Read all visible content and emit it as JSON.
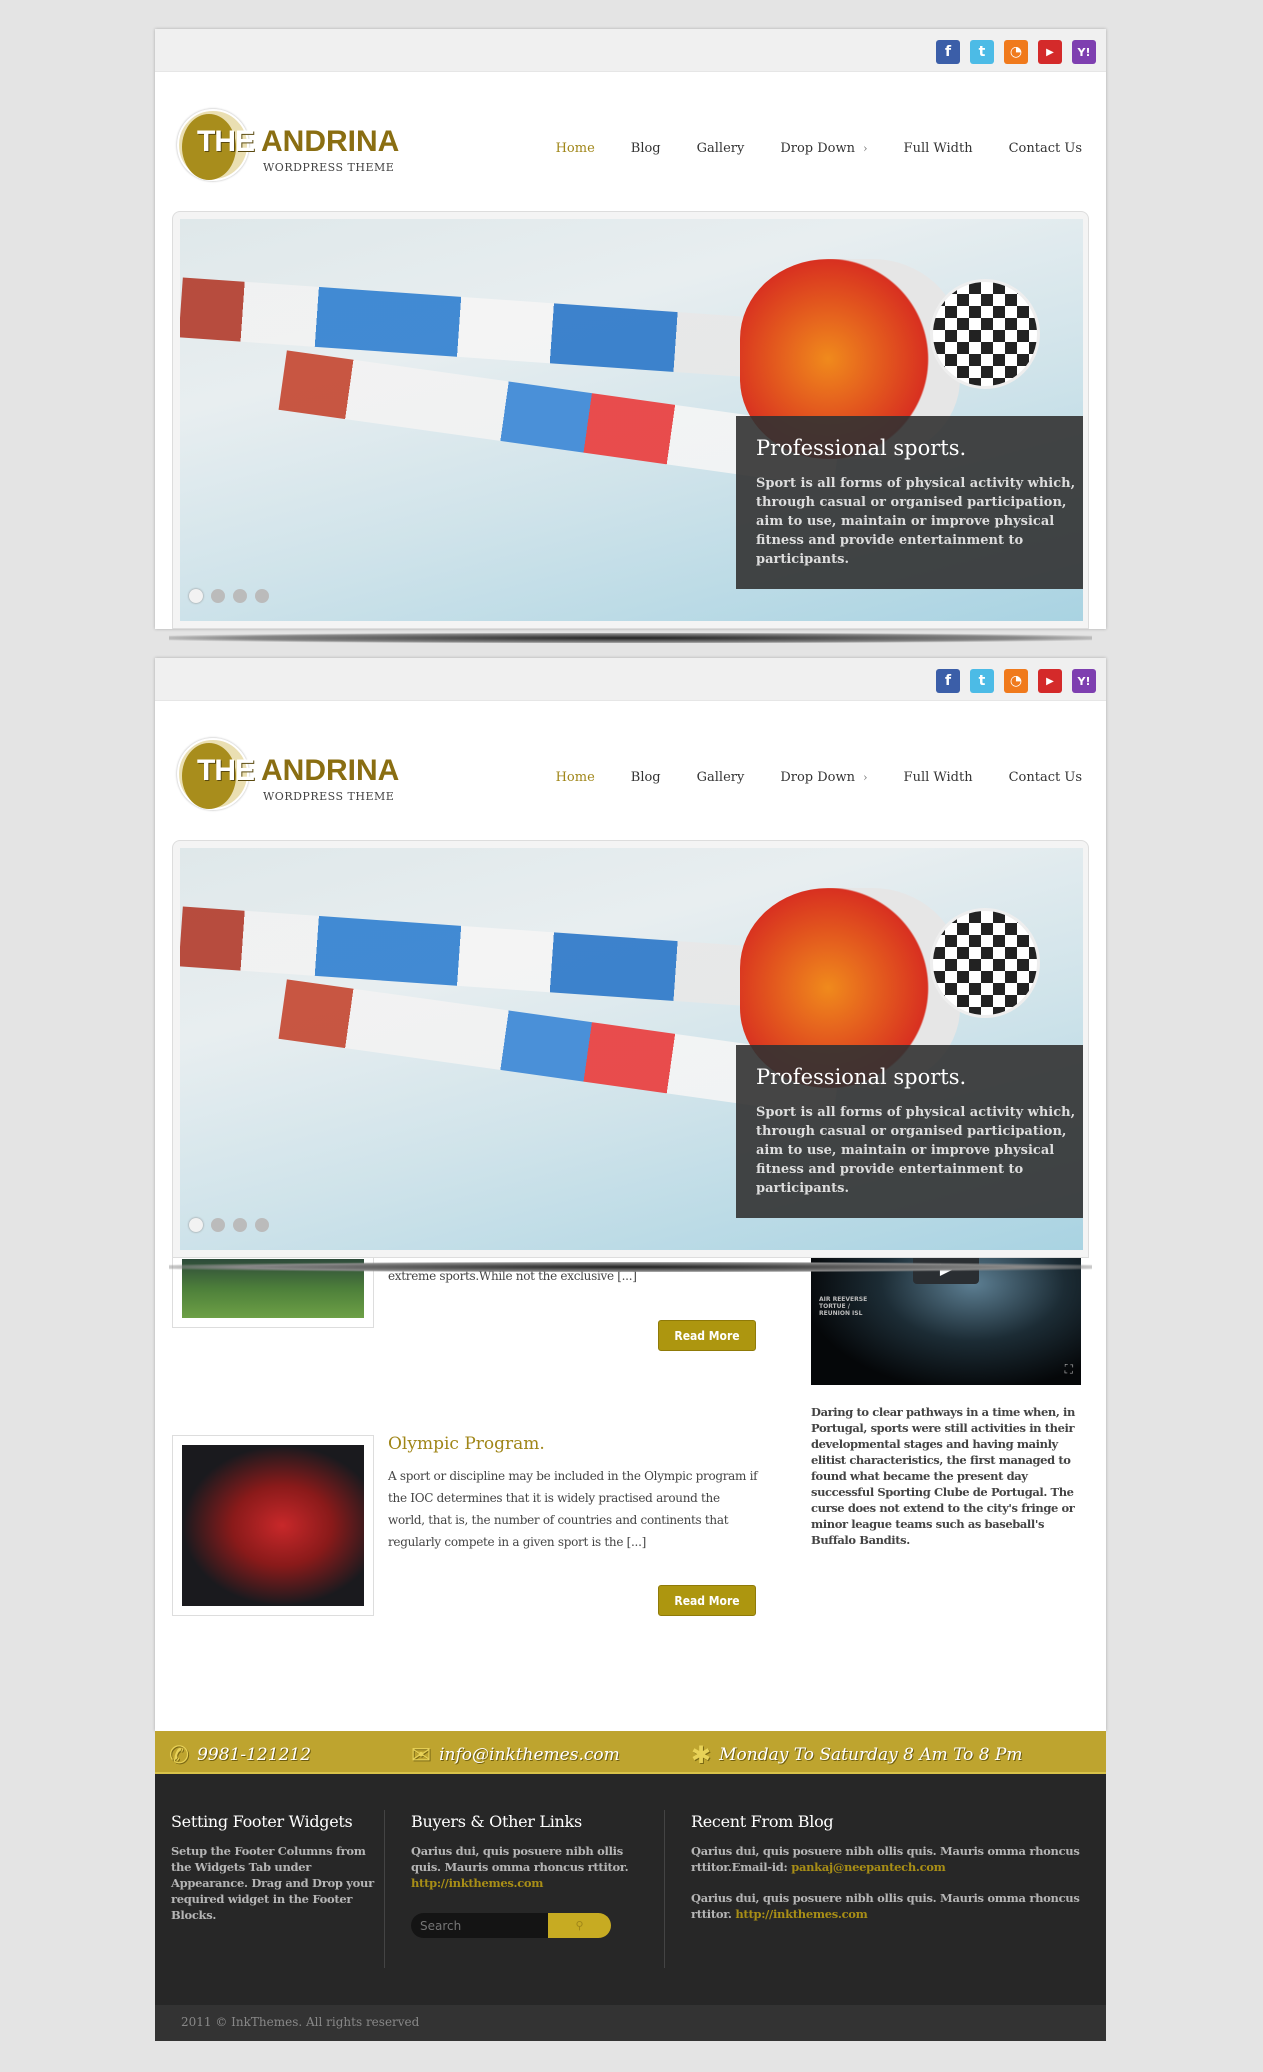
{
  "social": [
    {
      "name": "facebook-icon",
      "glyph": "f",
      "color": "#3b5ea8"
    },
    {
      "name": "twitter-icon",
      "glyph": "t",
      "color": "#4cbbe6"
    },
    {
      "name": "rss-icon",
      "glyph": "◔",
      "color": "#f07a1c"
    },
    {
      "name": "youtube-icon",
      "glyph": "▶",
      "color": "#d42a2a"
    },
    {
      "name": "yahoo-icon",
      "glyph": "Y!",
      "color": "#7e3fb0"
    }
  ],
  "logo": {
    "the": "THE",
    "name": "ANDRINA",
    "sub": "WORDPRESS THEME"
  },
  "nav": {
    "items": [
      "Home",
      "Blog",
      "Gallery",
      "Drop Down",
      "Full Width",
      "Contact Us"
    ],
    "active": "Home",
    "dropdown_arrow": "›"
  },
  "slider": {
    "title": "Professional sports.",
    "text": "Sport is all forms of physical activity which, through casual or organised participation, aim to use, maintain or improve physical fitness and provide entertainment to participants.",
    "slide_count": 4,
    "active_slide": 1
  },
  "posts": [
    {
      "excerpt_tail": "extreme sports.While not the exclusive [...]",
      "read_more": "Read More"
    },
    {
      "title": "Olympic Program.",
      "excerpt": "A sport or discipline may be included in the Olympic program if the IOC determines that it is widely practised around the world, that is, the number of countries and continents that regularly compete in a given sport is the [...]",
      "read_more": "Read More"
    }
  ],
  "sidebar": {
    "video_text": "AIR REEVERSE TORTUE / REUNION ISL",
    "text": "Daring to clear pathways in a time when, in Portugal, sports were still activities in their developmental stages and having mainly elitist characteristics, the first managed to found what became the present day successful Sporting Clube de Portugal. The curse does not extend to the city's fringe or minor league teams such as baseball's Buffalo Bandits."
  },
  "contact_bar": {
    "phone": "9981-121212",
    "email": "info@inkthemes.com",
    "hours": "Monday To Saturday 8 Am To 8 Pm"
  },
  "footer": {
    "col1": {
      "title": "Setting Footer Widgets",
      "text": "Setup the Footer Columns from the Widgets Tab under Appearance. Drag and Drop your required widget in the Footer Blocks."
    },
    "col2": {
      "title": "Buyers & Other Links",
      "text": "Qarius dui, quis posuere nibh ollis quis. Mauris omma rhoncus rttitor.",
      "link": "http://inkthemes.com",
      "search_placeholder": "Search"
    },
    "col3": {
      "title": "Recent From Blog",
      "p1": "Qarius dui, quis posuere nibh ollis quis. Mauris omma rhoncus rttitor.Email-id:",
      "p1_link": "pankaj@neepantech.com",
      "p2": "Qarius dui, quis posuere nibh ollis quis. Mauris omma rhoncus rttitor.",
      "p2_link": "http://inkthemes.com"
    }
  },
  "copyright": "2011 © InkThemes. All rights reserved",
  "colors": {
    "accent": "#a08618",
    "footer_bar": "#bea42f",
    "footer_bg": "#272727"
  }
}
